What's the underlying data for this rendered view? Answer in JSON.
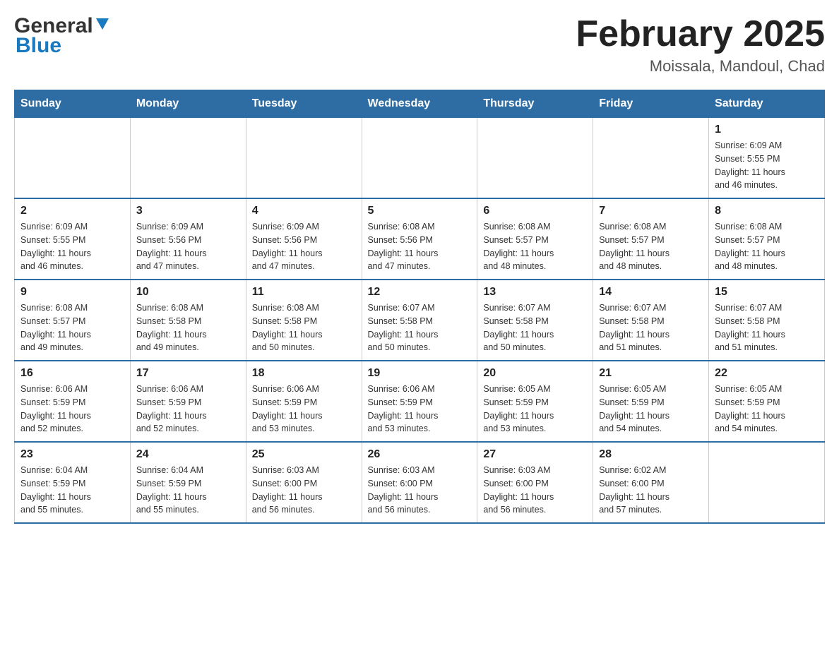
{
  "header": {
    "logo_general": "General",
    "logo_blue": "Blue",
    "title": "February 2025",
    "subtitle": "Moissala, Mandoul, Chad"
  },
  "days_of_week": [
    "Sunday",
    "Monday",
    "Tuesday",
    "Wednesday",
    "Thursday",
    "Friday",
    "Saturday"
  ],
  "weeks": [
    {
      "days": [
        {
          "number": "",
          "info": ""
        },
        {
          "number": "",
          "info": ""
        },
        {
          "number": "",
          "info": ""
        },
        {
          "number": "",
          "info": ""
        },
        {
          "number": "",
          "info": ""
        },
        {
          "number": "",
          "info": ""
        },
        {
          "number": "1",
          "info": "Sunrise: 6:09 AM\nSunset: 5:55 PM\nDaylight: 11 hours\nand 46 minutes."
        }
      ]
    },
    {
      "days": [
        {
          "number": "2",
          "info": "Sunrise: 6:09 AM\nSunset: 5:55 PM\nDaylight: 11 hours\nand 46 minutes."
        },
        {
          "number": "3",
          "info": "Sunrise: 6:09 AM\nSunset: 5:56 PM\nDaylight: 11 hours\nand 47 minutes."
        },
        {
          "number": "4",
          "info": "Sunrise: 6:09 AM\nSunset: 5:56 PM\nDaylight: 11 hours\nand 47 minutes."
        },
        {
          "number": "5",
          "info": "Sunrise: 6:08 AM\nSunset: 5:56 PM\nDaylight: 11 hours\nand 47 minutes."
        },
        {
          "number": "6",
          "info": "Sunrise: 6:08 AM\nSunset: 5:57 PM\nDaylight: 11 hours\nand 48 minutes."
        },
        {
          "number": "7",
          "info": "Sunrise: 6:08 AM\nSunset: 5:57 PM\nDaylight: 11 hours\nand 48 minutes."
        },
        {
          "number": "8",
          "info": "Sunrise: 6:08 AM\nSunset: 5:57 PM\nDaylight: 11 hours\nand 48 minutes."
        }
      ]
    },
    {
      "days": [
        {
          "number": "9",
          "info": "Sunrise: 6:08 AM\nSunset: 5:57 PM\nDaylight: 11 hours\nand 49 minutes."
        },
        {
          "number": "10",
          "info": "Sunrise: 6:08 AM\nSunset: 5:58 PM\nDaylight: 11 hours\nand 49 minutes."
        },
        {
          "number": "11",
          "info": "Sunrise: 6:08 AM\nSunset: 5:58 PM\nDaylight: 11 hours\nand 50 minutes."
        },
        {
          "number": "12",
          "info": "Sunrise: 6:07 AM\nSunset: 5:58 PM\nDaylight: 11 hours\nand 50 minutes."
        },
        {
          "number": "13",
          "info": "Sunrise: 6:07 AM\nSunset: 5:58 PM\nDaylight: 11 hours\nand 50 minutes."
        },
        {
          "number": "14",
          "info": "Sunrise: 6:07 AM\nSunset: 5:58 PM\nDaylight: 11 hours\nand 51 minutes."
        },
        {
          "number": "15",
          "info": "Sunrise: 6:07 AM\nSunset: 5:58 PM\nDaylight: 11 hours\nand 51 minutes."
        }
      ]
    },
    {
      "days": [
        {
          "number": "16",
          "info": "Sunrise: 6:06 AM\nSunset: 5:59 PM\nDaylight: 11 hours\nand 52 minutes."
        },
        {
          "number": "17",
          "info": "Sunrise: 6:06 AM\nSunset: 5:59 PM\nDaylight: 11 hours\nand 52 minutes."
        },
        {
          "number": "18",
          "info": "Sunrise: 6:06 AM\nSunset: 5:59 PM\nDaylight: 11 hours\nand 53 minutes."
        },
        {
          "number": "19",
          "info": "Sunrise: 6:06 AM\nSunset: 5:59 PM\nDaylight: 11 hours\nand 53 minutes."
        },
        {
          "number": "20",
          "info": "Sunrise: 6:05 AM\nSunset: 5:59 PM\nDaylight: 11 hours\nand 53 minutes."
        },
        {
          "number": "21",
          "info": "Sunrise: 6:05 AM\nSunset: 5:59 PM\nDaylight: 11 hours\nand 54 minutes."
        },
        {
          "number": "22",
          "info": "Sunrise: 6:05 AM\nSunset: 5:59 PM\nDaylight: 11 hours\nand 54 minutes."
        }
      ]
    },
    {
      "days": [
        {
          "number": "23",
          "info": "Sunrise: 6:04 AM\nSunset: 5:59 PM\nDaylight: 11 hours\nand 55 minutes."
        },
        {
          "number": "24",
          "info": "Sunrise: 6:04 AM\nSunset: 5:59 PM\nDaylight: 11 hours\nand 55 minutes."
        },
        {
          "number": "25",
          "info": "Sunrise: 6:03 AM\nSunset: 6:00 PM\nDaylight: 11 hours\nand 56 minutes."
        },
        {
          "number": "26",
          "info": "Sunrise: 6:03 AM\nSunset: 6:00 PM\nDaylight: 11 hours\nand 56 minutes."
        },
        {
          "number": "27",
          "info": "Sunrise: 6:03 AM\nSunset: 6:00 PM\nDaylight: 11 hours\nand 56 minutes."
        },
        {
          "number": "28",
          "info": "Sunrise: 6:02 AM\nSunset: 6:00 PM\nDaylight: 11 hours\nand 57 minutes."
        },
        {
          "number": "",
          "info": ""
        }
      ]
    }
  ]
}
